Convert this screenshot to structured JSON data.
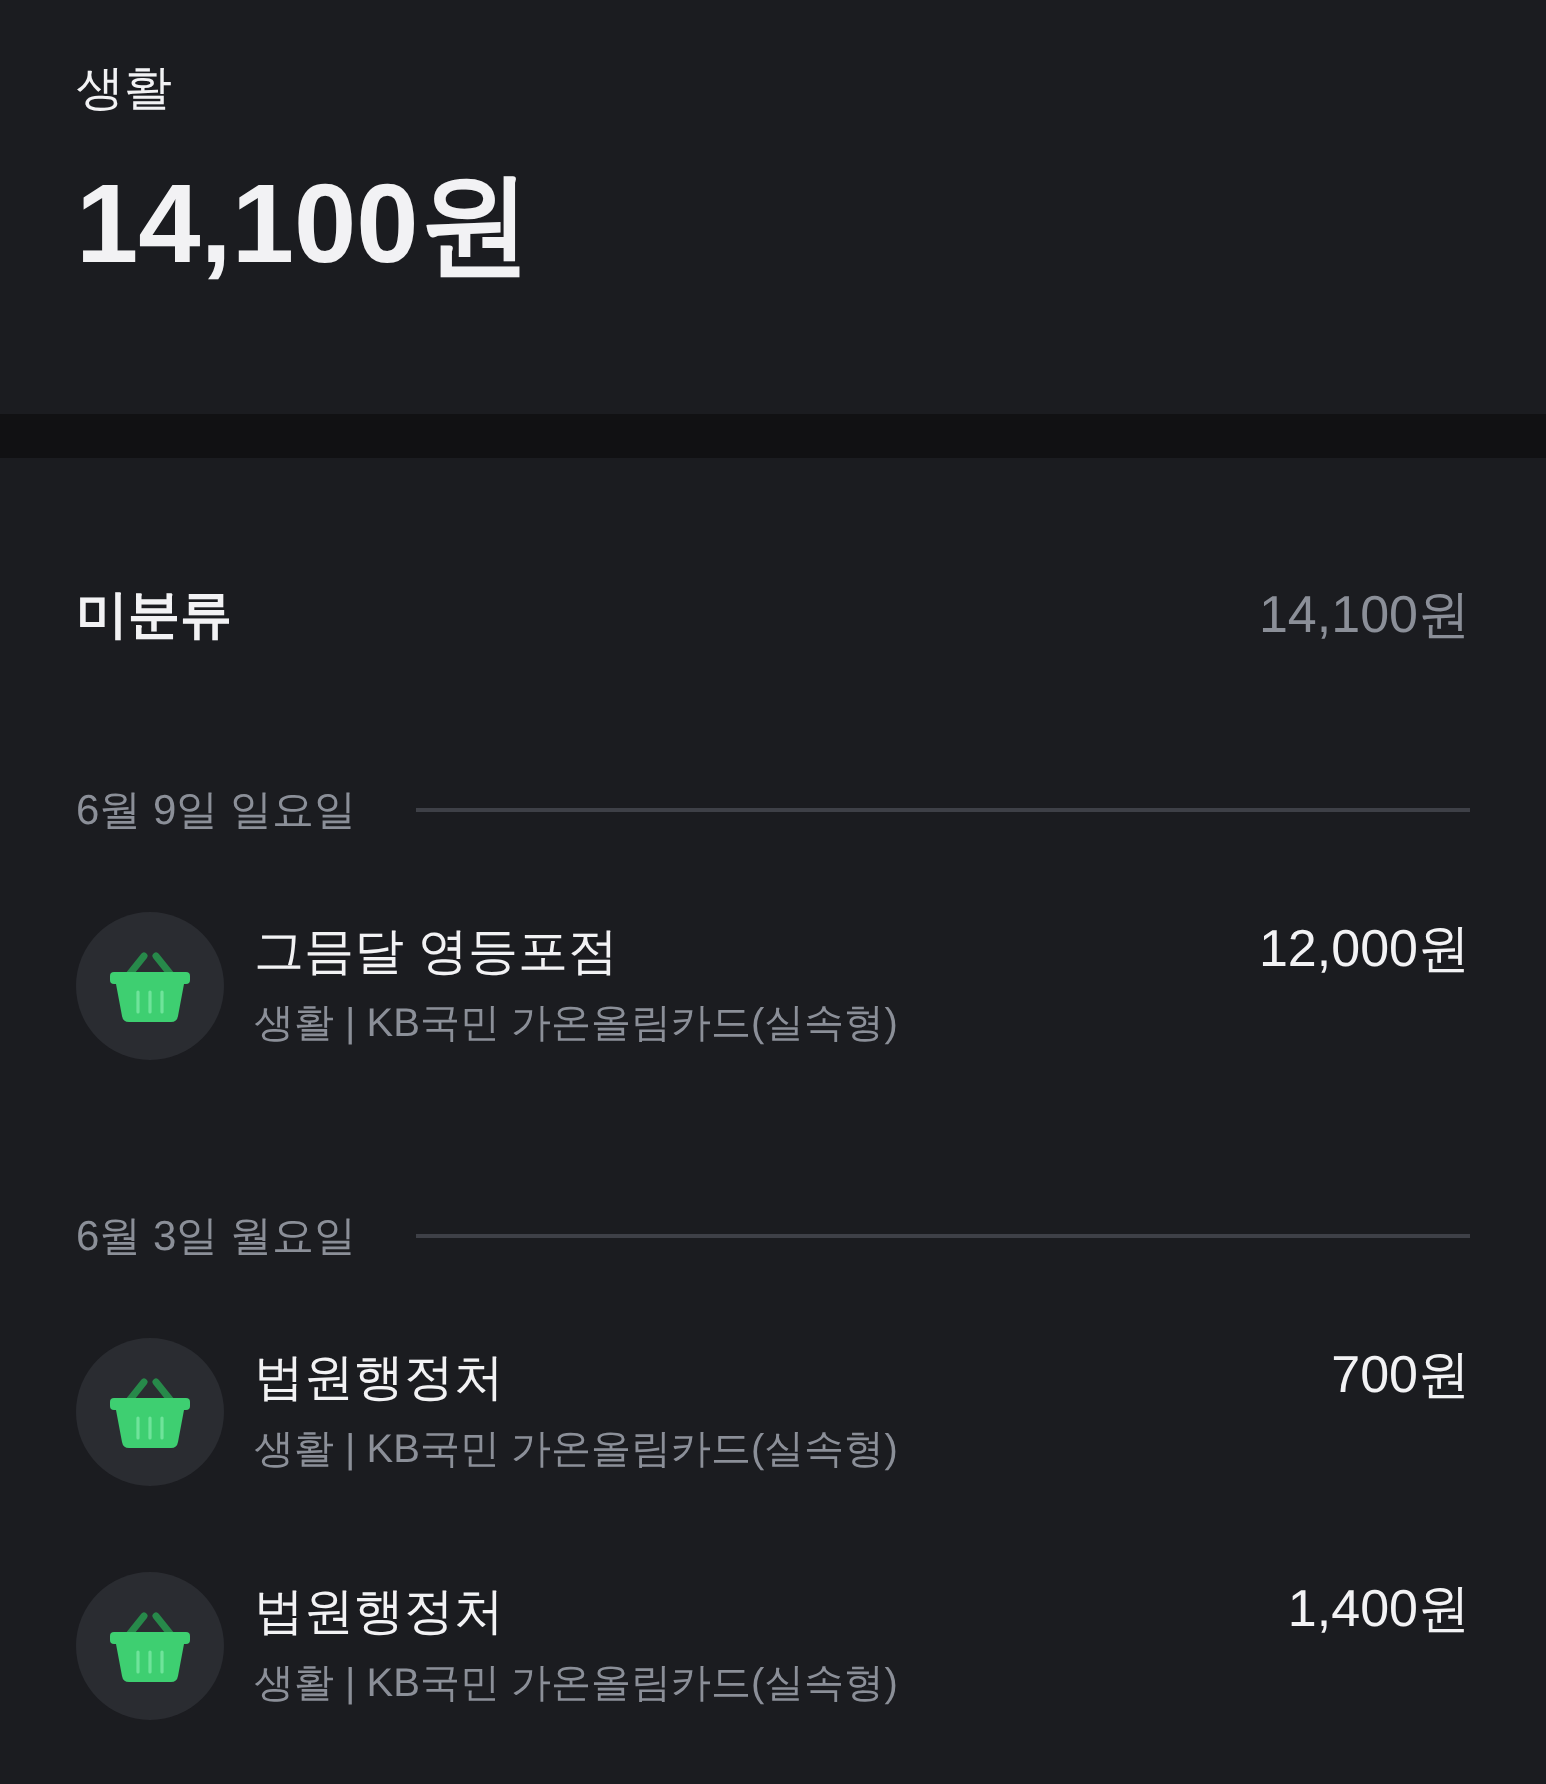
{
  "header": {
    "category": "생활",
    "total": "14,100원"
  },
  "section": {
    "title": "미분류",
    "total": "14,100원"
  },
  "groups": [
    {
      "date": "6월 9일 일요일",
      "transactions": [
        {
          "merchant": "그믐달 영등포점",
          "detail": "생활 | KB국민 가온올림카드(실속형)",
          "amount": "12,000원"
        }
      ]
    },
    {
      "date": "6월 3일 월요일",
      "transactions": [
        {
          "merchant": "법원행정처",
          "detail": "생활 | KB국민 가온올림카드(실속형)",
          "amount": "700원"
        },
        {
          "merchant": "법원행정처",
          "detail": "생활 | KB국민 가온올림카드(실속형)",
          "amount": "1,400원"
        }
      ]
    }
  ]
}
